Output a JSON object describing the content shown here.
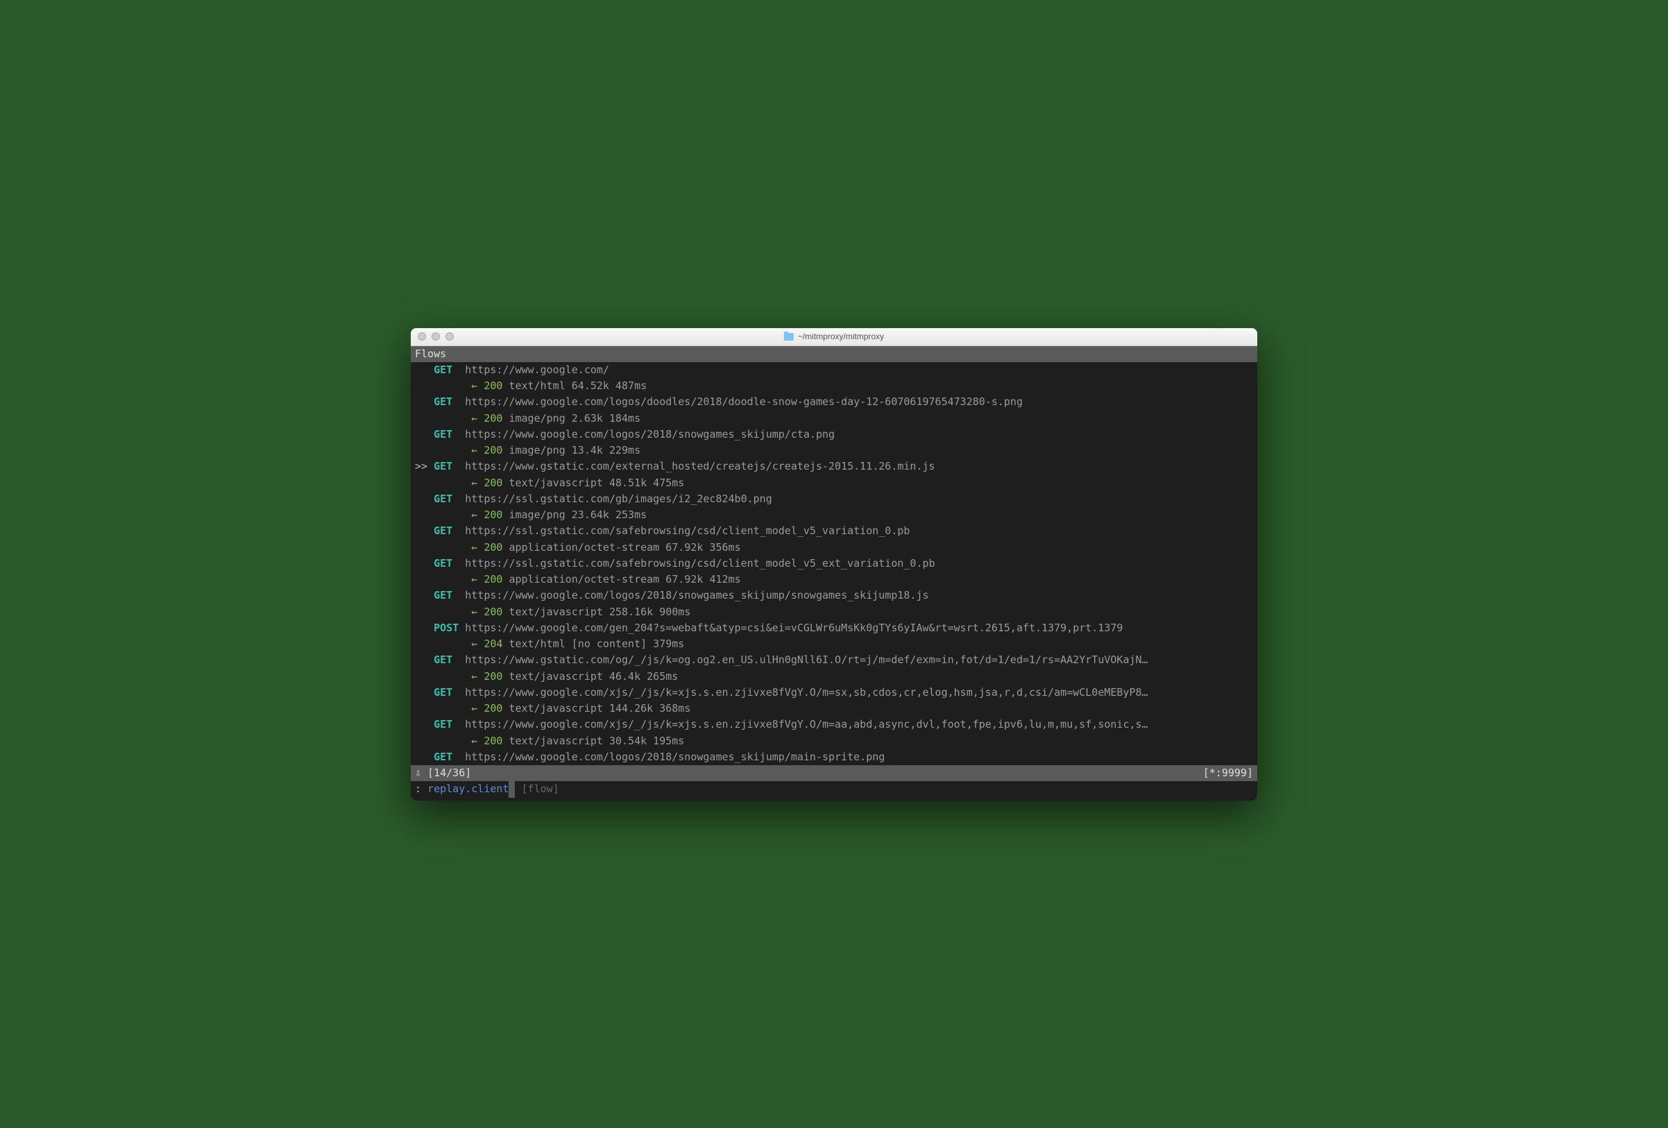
{
  "window": {
    "title": "~/mitmproxy/mitmproxy"
  },
  "header": "Flows",
  "flows": [
    {
      "cursor": "",
      "method": "GET",
      "url": "https://www.google.com/",
      "status": "200",
      "ctype": "text/html",
      "size": "64.52k",
      "time": "487ms"
    },
    {
      "cursor": "",
      "method": "GET",
      "url": "https://www.google.com/logos/doodles/2018/doodle-snow-games-day-12-6070619765473280-s.png",
      "status": "200",
      "ctype": "image/png",
      "size": "2.63k",
      "time": "184ms"
    },
    {
      "cursor": "",
      "method": "GET",
      "url": "https://www.google.com/logos/2018/snowgames_skijump/cta.png",
      "status": "200",
      "ctype": "image/png",
      "size": "13.4k",
      "time": "229ms"
    },
    {
      "cursor": ">>",
      "method": "GET",
      "url": "https://www.gstatic.com/external_hosted/createjs/createjs-2015.11.26.min.js",
      "status": "200",
      "ctype": "text/javascript",
      "size": "48.51k",
      "time": "475ms"
    },
    {
      "cursor": "",
      "method": "GET",
      "url": "https://ssl.gstatic.com/gb/images/i2_2ec824b0.png",
      "status": "200",
      "ctype": "image/png",
      "size": "23.64k",
      "time": "253ms"
    },
    {
      "cursor": "",
      "method": "GET",
      "url": "https://ssl.gstatic.com/safebrowsing/csd/client_model_v5_variation_0.pb",
      "status": "200",
      "ctype": "application/octet-stream",
      "size": "67.92k",
      "time": "356ms"
    },
    {
      "cursor": "",
      "method": "GET",
      "url": "https://ssl.gstatic.com/safebrowsing/csd/client_model_v5_ext_variation_0.pb",
      "status": "200",
      "ctype": "application/octet-stream",
      "size": "67.92k",
      "time": "412ms"
    },
    {
      "cursor": "",
      "method": "GET",
      "url": "https://www.google.com/logos/2018/snowgames_skijump/snowgames_skijump18.js",
      "status": "200",
      "ctype": "text/javascript",
      "size": "258.16k",
      "time": "900ms"
    },
    {
      "cursor": "",
      "method": "POST",
      "url": "https://www.google.com/gen_204?s=webaft&atyp=csi&ei=vCGLWr6uMsKk0gTYs6yIAw&rt=wsrt.2615,aft.1379,prt.1379",
      "status": "204",
      "ctype": "text/html",
      "size": "[no content]",
      "time": "379ms"
    },
    {
      "cursor": "",
      "method": "GET",
      "url": "https://www.gstatic.com/og/_/js/k=og.og2.en_US.ulHn0gNll6I.O/rt=j/m=def/exm=in,fot/d=1/ed=1/rs=AA2YrTuVOKajN…",
      "status": "200",
      "ctype": "text/javascript",
      "size": "46.4k",
      "time": "265ms"
    },
    {
      "cursor": "",
      "method": "GET",
      "url": "https://www.google.com/xjs/_/js/k=xjs.s.en.zjivxe8fVgY.O/m=sx,sb,cdos,cr,elog,hsm,jsa,r,d,csi/am=wCL0eMEByP8…",
      "status": "200",
      "ctype": "text/javascript",
      "size": "144.26k",
      "time": "368ms"
    },
    {
      "cursor": "",
      "method": "GET",
      "url": "https://www.google.com/xjs/_/js/k=xjs.s.en.zjivxe8fVgY.O/m=aa,abd,async,dvl,foot,fpe,ipv6,lu,m,mu,sf,sonic,s…",
      "status": "200",
      "ctype": "text/javascript",
      "size": "30.54k",
      "time": "195ms"
    },
    {
      "cursor": "",
      "method": "GET",
      "url": "https://www.google.com/logos/2018/snowgames_skijump/main-sprite.png",
      "status": "",
      "ctype": "",
      "size": "",
      "time": ""
    }
  ],
  "status_bar": {
    "arrow": "⇩",
    "position": "[14/36]",
    "listen": "[*:9999]"
  },
  "command": {
    "prompt": ":",
    "text": "replay.client",
    "placeholder": "[flow]"
  }
}
